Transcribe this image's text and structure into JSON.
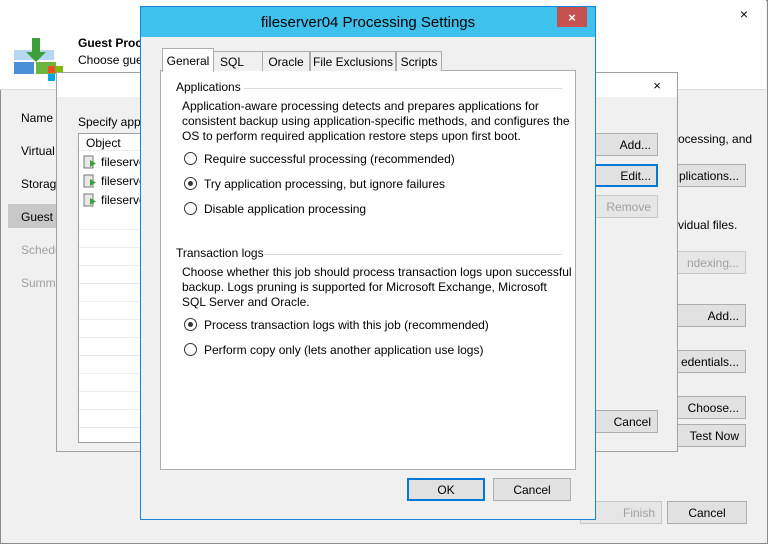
{
  "wizard": {
    "close_glyph": "×",
    "title": "Guest Proc",
    "subtitle": "Choose gue",
    "nav": [
      {
        "label": "Name",
        "disabled": false
      },
      {
        "label": "Virtual",
        "disabled": false
      },
      {
        "label": "Storage",
        "disabled": false
      },
      {
        "label": "Guest P",
        "disabled": false,
        "selected": true
      },
      {
        "label": "Schedu",
        "disabled": true
      },
      {
        "label": "Summ",
        "disabled": true
      }
    ],
    "right_text": {
      "processing": "ocessing, and",
      "individual": "vidual files."
    },
    "right_buttons": {
      "applications": "plications...",
      "indexing": "ndexing...",
      "add": "Add...",
      "credentials": "edentials...",
      "choose": "Choose...",
      "test_now": "Test Now"
    },
    "footer": {
      "finish": "Finish",
      "cancel": "Cancel"
    }
  },
  "middle_dialog": {
    "close_glyph": "×",
    "prompt": "Specify appl",
    "column_header": "Object",
    "rows": [
      "fileserver",
      "fileserver",
      "fileserver"
    ],
    "buttons": {
      "add": "Add...",
      "edit": "Edit...",
      "remove": "Remove",
      "cancel": "Cancel"
    }
  },
  "dialog": {
    "title": "fileserver04 Processing Settings",
    "close_glyph": "×",
    "tabs": [
      "General",
      "SQL",
      "Oracle",
      "File Exclusions",
      "Scripts"
    ],
    "active_tab": "General",
    "applications": {
      "label": "Applications",
      "description": "Application-aware processing detects and prepares applications for consistent backup using application-specific methods, and configures the OS to perform required application restore steps upon first boot.",
      "options": [
        {
          "label": "Require successful processing  (recommended)",
          "checked": false
        },
        {
          "label": "Try application processing, but ignore failures",
          "checked": true
        },
        {
          "label": "Disable application processing",
          "checked": false
        }
      ]
    },
    "transaction_logs": {
      "label": "Transaction logs",
      "description": "Choose whether this job should process transaction logs upon successful backup. Logs pruning is supported for Microsoft Exchange, Microsoft SQL Server and Oracle.",
      "options": [
        {
          "label": "Process transaction logs with this job (recommended)",
          "checked": true
        },
        {
          "label": "Perform copy only (lets another application use logs)",
          "checked": false
        }
      ]
    },
    "buttons": {
      "ok": "OK",
      "cancel": "Cancel"
    }
  },
  "colors": {
    "dialog_titlebar": "#3fc1ee",
    "close_button": "#c75050",
    "focus_border": "#0078d7"
  }
}
